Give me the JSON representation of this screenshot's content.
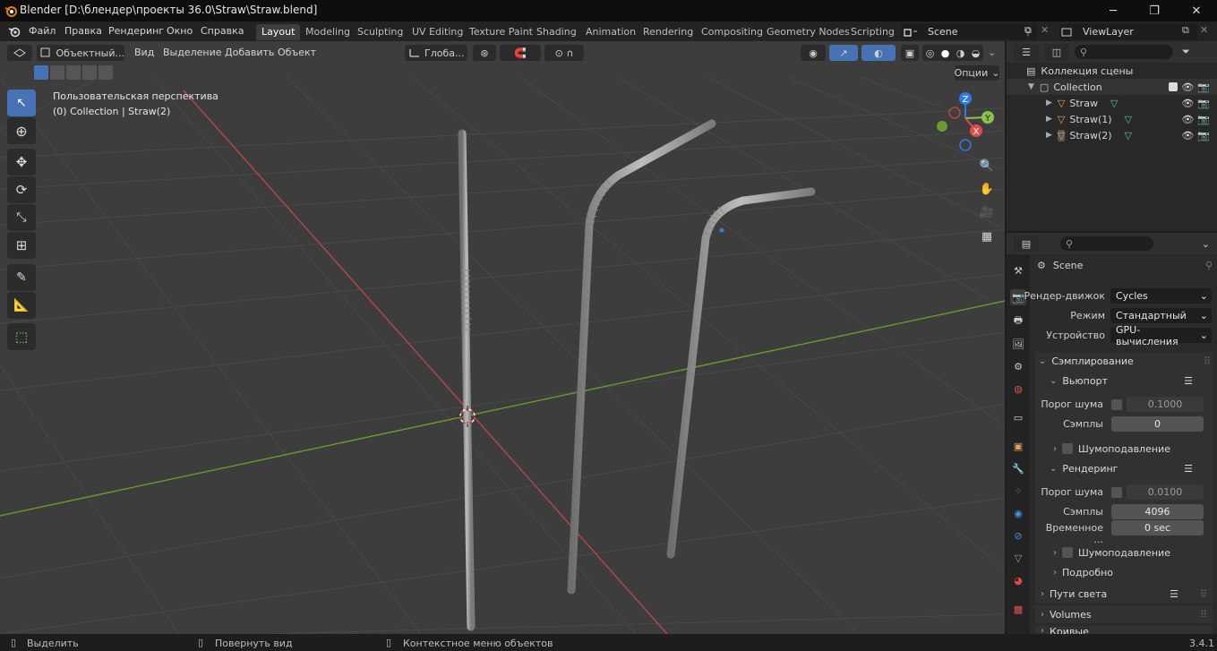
{
  "window": {
    "title": "Blender [D:\\блендер\\проекты 36.0\\Straw\\Straw.blend]",
    "minimize": "─",
    "maximize": "❐",
    "close": "✕"
  },
  "menu": {
    "items": [
      "Файл",
      "Правка",
      "Рендеринг",
      "Окно",
      "Справка"
    ]
  },
  "workspaces": {
    "tabs": [
      "Layout",
      "Modeling",
      "Sculpting",
      "UV Editing",
      "Texture Paint",
      "Shading",
      "Animation",
      "Rendering",
      "Compositing",
      "Geometry Nodes",
      "Scripting"
    ],
    "active": "Layout"
  },
  "scene_selector": {
    "value": "Scene"
  },
  "viewlayer_selector": {
    "value": "ViewLayer"
  },
  "viewport_header": {
    "mode": "Объектный...",
    "menus": [
      "Вид",
      "Выделение",
      "Добавить",
      "Объект"
    ],
    "orientation": "Глоба...",
    "options_label": "Опции"
  },
  "viewport": {
    "perspective_label": "Пользовательская перспектива",
    "collection_label": "(0) Collection | Straw(2)",
    "gizmo": {
      "z": "Z",
      "y": "Y",
      "x": "X"
    }
  },
  "outliner": {
    "root": "Коллекция сцены",
    "collection": "Collection",
    "objects": [
      "Straw",
      "Straw(1)",
      "Straw(2)"
    ]
  },
  "properties": {
    "scene_name": "Scene",
    "render_engine_label": "Рендер-движок",
    "render_engine": "Cycles",
    "mode_label": "Режим",
    "mode": "Стандартный",
    "device_label": "Устройство",
    "device": "GPU-вычисления",
    "sampling_title": "Сэмплирование",
    "viewport_title": "Вьюпорт",
    "noise_threshold_label": "Порог шума",
    "viewport_noise_threshold": "0.1000",
    "samples_label": "Сэмплы",
    "viewport_samples": "0",
    "denoise_label": "Шумоподавление",
    "render_title": "Рендеринг",
    "render_noise_threshold": "0.0100",
    "render_samples": "4096",
    "time_label": "Временное ...",
    "time_value": "0 sec",
    "details_label": "Подробно",
    "light_paths_label": "Пути света",
    "volumes_label": "Volumes",
    "curves_label": "Кривые"
  },
  "statusbar": {
    "select": "Выделить",
    "rotate": "Повернуть вид",
    "context": "Контекстное меню объектов",
    "version": "3.4.1"
  },
  "colors": {
    "accent": "#4772b3",
    "x_axis": "#e14b4b",
    "y_axis": "#8bc34a",
    "z_axis": "#2e7be8"
  }
}
